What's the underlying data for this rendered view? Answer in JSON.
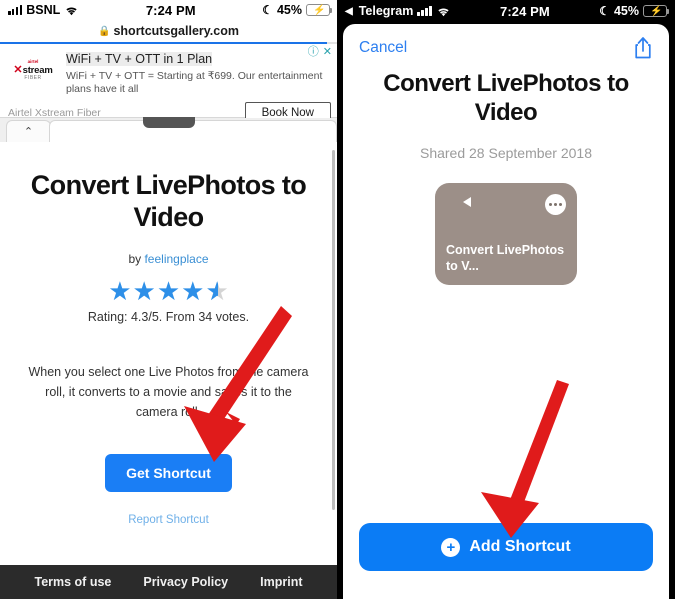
{
  "left": {
    "status": {
      "carrier": "BSNL",
      "wifi_icon": "wifi-icon",
      "time": "7:24 PM",
      "moon_icon": "moon-icon",
      "battery": "45%",
      "charging_icon": "bolt-icon"
    },
    "url": {
      "lock_icon": "lock-icon",
      "domain": "shortcutsgallery.com"
    },
    "ad": {
      "title": "WiFi + TV + OTT in 1 Plan",
      "description": "WiFi + TV + OTT = Starting at ₹699. Our entertainment plans have it all",
      "brand": "Airtel Xstream Fiber",
      "cta": "Book Now",
      "logo_x": "✕",
      "logo_name": "stream",
      "logo_sub": "FIBER",
      "logo_airtel": "airtel",
      "info_icon": "ⓘ",
      "close_icon": "✕"
    },
    "tabs": {
      "chevron_icon": "chevron-up-icon"
    },
    "page": {
      "title": "Convert LivePhotos to Video",
      "by_prefix": "by ",
      "author": "feelingplace",
      "stars_filled": 4,
      "stars_half": 1,
      "rating_text": "Rating: 4.3/5. From 34 votes.",
      "description": "When you select one Live Photos from the camera roll, it converts to a movie and saves it to the camera roll.",
      "get_button": "Get Shortcut",
      "report_link": "Report Shortcut"
    },
    "footer": {
      "terms": "Terms of use",
      "privacy": "Privacy Policy",
      "imprint": "Imprint"
    }
  },
  "right": {
    "status": {
      "back_app": "Telegram",
      "back_icon": "back-triangle-icon",
      "wifi_icon": "wifi-icon",
      "time": "7:24 PM",
      "moon_icon": "moon-icon",
      "battery": "45%",
      "charging_icon": "bolt-icon"
    },
    "sheet": {
      "cancel": "Cancel",
      "share_icon": "share-icon",
      "title": "Convert LivePhotos to Video",
      "shared": "Shared 28 September 2018",
      "card": {
        "icon": "video-camera-icon",
        "menu_icon": "ellipsis-icon",
        "label": "Convert LivePhotos to V...",
        "color": "#9c8f88"
      },
      "add_button": "Add Shortcut",
      "add_icon": "plus-circle-icon"
    }
  },
  "annotations": {
    "arrow_color": "#e01b1b",
    "arrow_left": "arrow-to-get-shortcut",
    "arrow_right": "arrow-to-add-shortcut"
  },
  "colors": {
    "accent_blue": "#1a7ef5",
    "ios_blue": "#0b7cf5",
    "star_blue": "#2d8fe8",
    "footer_bg": "#2b2b2b"
  }
}
